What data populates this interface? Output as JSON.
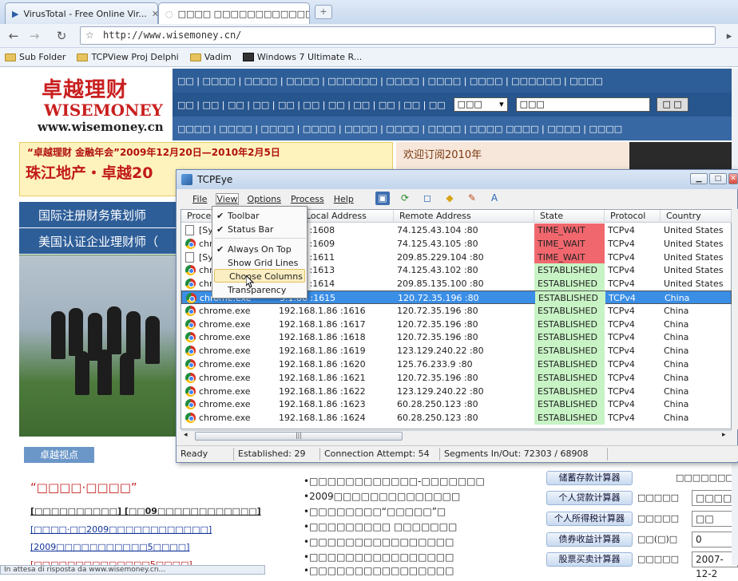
{
  "browser": {
    "tabs": [
      {
        "title": "VirusTotal - Free Online Vir..."
      },
      {
        "title": "□□□□ □□□□□□□□□□□□"
      }
    ],
    "url": "http://www.wisemoney.cn/",
    "bookmarks": [
      "Sub Folder",
      "TCPView Proj Delphi",
      "Vadim",
      "Windows 7 Ultimate R..."
    ],
    "status_text": "In attesa di risposta da www.wisemoney.cn..."
  },
  "site": {
    "logo_cn": "卓越理财",
    "logo_en": "WISEMONEY",
    "logo_url": "www.wisemoney.cn",
    "nav1": "□□ | □□□□ | □□□□ | □□□□ | □□□□□□ | □□□□ | □□□□ | □□□□ | □□□□□□ | □□□□",
    "nav2": "□□ | □□ | □□ | □□ | □□ | □□ | □□ | □□ | □□ | □□ | □□",
    "nav2_select": "□□□",
    "nav2_search": "□□□",
    "nav2_button": "□ □",
    "nav3": "□□□□ | □□□□ | □□□□ | □□□□ | □□□□ | □□□□ | □□□□ | □□□□    □□□□ | □□□□ | □□□□",
    "banner_title": "“卓越理财 金融年会”2009年12月20日—2010年2月5日",
    "banner_subtitle": "珠江地产・卓越20",
    "banner_right": "欢迎订阅2010年",
    "left_title1": "国际注册财务策划师",
    "left_title2": "美国认证企业理财师（",
    "view_header": "卓越视点",
    "quote": "“□□□□·□□□□”",
    "left_links": [
      "[□□□□□□□□□□] [□□09□□□□□□□□□□□□]",
      "[□□□□·□□2009□□□□□□□□□□□□]",
      "[2009□□□□□□□□□□□5□□□□]",
      "[□□□□□□□□□□□□□□5□□□□]"
    ],
    "mid_list": [
      "•□□□□□□□□□□□□-□□□□□□□",
      "•2009□□□□□□□□□□□□□□",
      "•□□□□□□□□“□□□□□”□",
      "•□□□□□□□□□ □□□□□□□",
      "•□□□□□□□□□□□□□□□□",
      "•□□□□□□□□□□□□□□□□",
      "•□□□□□□□□□□□□□□□□"
    ],
    "calc_header_right": "□□□□□□□□",
    "calculators": [
      {
        "label": "储蓄存款计算器",
        "text": "",
        "input": ""
      },
      {
        "label": "个人贷款计算器",
        "text": "□□□□□",
        "input": "□□□□"
      },
      {
        "label": "个人所得税计算器",
        "text": "□□□□□",
        "input": "□□"
      },
      {
        "label": "债券收益计算器",
        "text": "□□(□)□",
        "input": "0"
      },
      {
        "label": "股票买卖计算器",
        "text": "□□□□□",
        "input": "2007-12-2"
      }
    ]
  },
  "tcpeye": {
    "title": "TCPEye",
    "menu": [
      "File",
      "View",
      "Options",
      "Process",
      "Help"
    ],
    "columns": [
      "Process",
      "Local Address",
      "Remote Address",
      "State",
      "Protocol",
      "Country"
    ],
    "view_menu": [
      {
        "label": "Toolbar",
        "checked": true
      },
      {
        "label": "Status Bar",
        "checked": true
      },
      {
        "label": "Always On Top",
        "checked": true
      },
      {
        "label": "Show Grid Lines",
        "checked": false
      },
      {
        "label": "Choose Columns",
        "checked": false
      },
      {
        "label": "Transparency",
        "checked": false
      }
    ],
    "rows": [
      {
        "process": "[Sys",
        "local": "3.1.86 :1608",
        "remote": "74.125.43.104 :80",
        "state": "TIME_WAIT",
        "proto": "TCPv4",
        "country": "United States",
        "icon": "system"
      },
      {
        "process": "chro",
        "local": "3.1.86 :1609",
        "remote": "74.125.43.105 :80",
        "state": "TIME_WAIT",
        "proto": "TCPv4",
        "country": "United States",
        "icon": "chrome"
      },
      {
        "process": "[Sys",
        "local": "3.1.86 :1611",
        "remote": "209.85.229.104 :80",
        "state": "TIME_WAIT",
        "proto": "TCPv4",
        "country": "United States",
        "icon": "system"
      },
      {
        "process": "chro",
        "local": "3.1.86 :1613",
        "remote": "74.125.43.102 :80",
        "state": "ESTABLISHED",
        "proto": "TCPv4",
        "country": "United States",
        "icon": "chrome"
      },
      {
        "process": "chro",
        "local": "3.1.86 :1614",
        "remote": "209.85.135.100 :80",
        "state": "ESTABLISHED",
        "proto": "TCPv4",
        "country": "United States",
        "icon": "chrome"
      },
      {
        "process": "chrome.exe",
        "local": "3.1.86 :1615",
        "remote": "120.72.35.196 :80",
        "state": "ESTABLISHED",
        "proto": "TCPv4",
        "country": "China",
        "icon": "chrome",
        "selected": true
      },
      {
        "process": "chrome.exe",
        "local": "192.168.1.86 :1616",
        "remote": "120.72.35.196 :80",
        "state": "ESTABLISHED",
        "proto": "TCPv4",
        "country": "China",
        "icon": "chrome"
      },
      {
        "process": "chrome.exe",
        "local": "192.168.1.86 :1617",
        "remote": "120.72.35.196 :80",
        "state": "ESTABLISHED",
        "proto": "TCPv4",
        "country": "China",
        "icon": "chrome"
      },
      {
        "process": "chrome.exe",
        "local": "192.168.1.86 :1618",
        "remote": "120.72.35.196 :80",
        "state": "ESTABLISHED",
        "proto": "TCPv4",
        "country": "China",
        "icon": "chrome"
      },
      {
        "process": "chrome.exe",
        "local": "192.168.1.86 :1619",
        "remote": "123.129.240.22 :80",
        "state": "ESTABLISHED",
        "proto": "TCPv4",
        "country": "China",
        "icon": "chrome"
      },
      {
        "process": "chrome.exe",
        "local": "192.168.1.86 :1620",
        "remote": "125.76.233.9 :80",
        "state": "ESTABLISHED",
        "proto": "TCPv4",
        "country": "China",
        "icon": "chrome"
      },
      {
        "process": "chrome.exe",
        "local": "192.168.1.86 :1621",
        "remote": "120.72.35.196 :80",
        "state": "ESTABLISHED",
        "proto": "TCPv4",
        "country": "China",
        "icon": "chrome"
      },
      {
        "process": "chrome.exe",
        "local": "192.168.1.86 :1622",
        "remote": "123.129.240.22 :80",
        "state": "ESTABLISHED",
        "proto": "TCPv4",
        "country": "China",
        "icon": "chrome"
      },
      {
        "process": "chrome.exe",
        "local": "192.168.1.86 :1623",
        "remote": "60.28.250.123 :80",
        "state": "ESTABLISHED",
        "proto": "TCPv4",
        "country": "China",
        "icon": "chrome"
      },
      {
        "process": "chrome.exe",
        "local": "192.168.1.86 :1624",
        "remote": "60.28.250.123 :80",
        "state": "ESTABLISHED",
        "proto": "TCPv4",
        "country": "China",
        "icon": "chrome"
      }
    ],
    "status": [
      "Ready",
      "Established: 29",
      "Connection Attempt: 54",
      "Segments In/Out: 72303 / 68908"
    ]
  }
}
